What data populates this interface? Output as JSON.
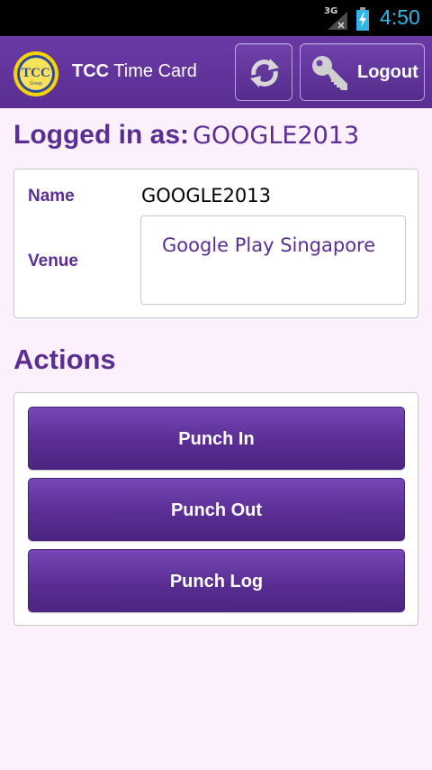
{
  "status_bar": {
    "network": "3G",
    "time": "4:50"
  },
  "header": {
    "logo_text": "TCC",
    "logo_subtext": "Group",
    "title_bold": "TCC",
    "title_rest": " Time Card",
    "logout_label": "Logout",
    "accent_color": "#5a2e93"
  },
  "session": {
    "logged_in_label": "Logged in as:",
    "user": "GOOGLE2013"
  },
  "info": {
    "name_label": "Name",
    "name_value": "GOOGLE2013",
    "venue_label": "Venue",
    "venue_value": "Google Play Singapore"
  },
  "actions": {
    "title": "Actions",
    "punch_in": "Punch In",
    "punch_out": "Punch Out",
    "punch_log": "Punch Log"
  },
  "icons": [
    "signal-icon",
    "battery-charging-icon",
    "tcc-logo",
    "refresh-icon",
    "key-icon"
  ]
}
